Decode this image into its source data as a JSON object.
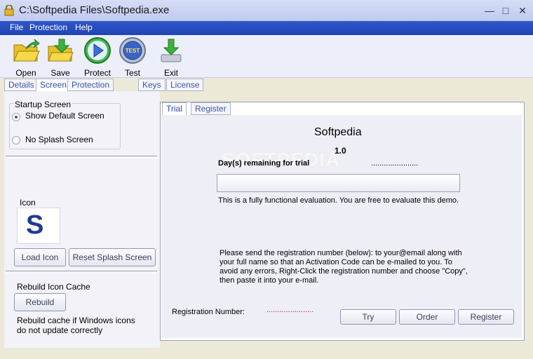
{
  "window": {
    "title": "C:\\Softpedia Files\\Softpedia.exe"
  },
  "menu": {
    "items": [
      "File",
      "Protection",
      "Help"
    ]
  },
  "toolbar": {
    "items": [
      {
        "label": "Open",
        "icon": "open-folder-icon"
      },
      {
        "label": "Save",
        "icon": "save-folder-icon"
      },
      {
        "label": "Protect",
        "icon": "protect-play-icon"
      },
      {
        "label": "Test",
        "icon": "test-icon"
      },
      {
        "label": "Exit",
        "icon": "exit-icon"
      }
    ]
  },
  "tabs": [
    "Details",
    "Screen",
    "Protection Options",
    "Keys",
    "License"
  ],
  "startup": {
    "group_label": "Startup Screen",
    "option_default": "Show Default Screen",
    "option_none": "No Splash Screen"
  },
  "icon_section": {
    "label": "Icon",
    "icon_letter": "S",
    "load_button": "Load Icon",
    "reset_button": "Reset Splash Screen"
  },
  "cache": {
    "label": "Rebuild Icon Cache",
    "button": "Rebuild",
    "note_line1": "Rebuild cache if Windows icons",
    "note_line2": "do not update correctly"
  },
  "preview": {
    "tabs": [
      "Trial",
      "Register"
    ],
    "app_name": "Softpedia",
    "version": "1.0",
    "watermark": "SOFTPEDIA",
    "days_label": "Day(s) remaining for trial",
    "days_value": "......................",
    "eval_text": "This is a fully functional evaluation. You are free to evaluate this demo.",
    "instr_line1": "Please send the registration number (below): to your@email  along with",
    "instr_line2": "your full name so that an Activation Code can be e-mailed to you. To",
    "instr_line3": "avoid any errors, Right-Click the registration number and choose \"Copy\",",
    "instr_line4": "then paste it into your e-mail.",
    "reg_label": "Registration Number:",
    "reg_value": "......................",
    "buttons": [
      "Try",
      "Order",
      "Register"
    ]
  },
  "colors": {
    "menubar": "#1f44b6",
    "tab_text": "#3a55a6",
    "accent": "#2d4aa8"
  }
}
